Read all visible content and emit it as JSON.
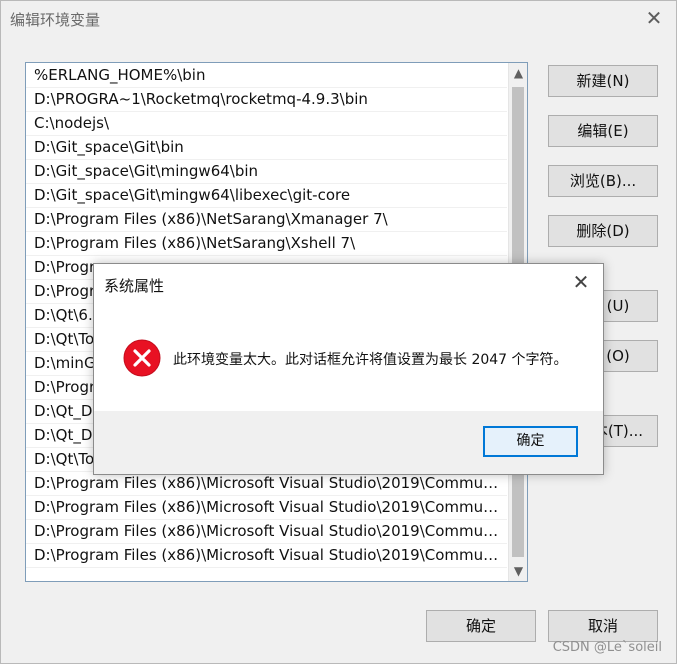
{
  "window": {
    "title": "编辑环境变量",
    "close_glyph": "✕"
  },
  "paths": [
    "%ERLANG_HOME%\\bin",
    "D:\\PROGRA~1\\Rocketmq\\rocketmq-4.9.3\\bin",
    "C:\\nodejs\\",
    "D:\\Git_space\\Git\\bin",
    "D:\\Git_space\\Git\\mingw64\\bin",
    "D:\\Git_space\\Git\\mingw64\\libexec\\git-core",
    "D:\\Program Files (x86)\\NetSarang\\Xmanager 7\\",
    "D:\\Program Files (x86)\\NetSarang\\Xshell 7\\",
    "D:\\Progr",
    "D:\\Progr",
    "D:\\Qt\\6.6",
    "D:\\Qt\\To",
    "D:\\minGw",
    "D:\\Progr",
    "D:\\Qt_De",
    "D:\\Qt_De",
    "D:\\Qt\\To",
    "D:\\Program Files (x86)\\Microsoft Visual Studio\\2019\\Communit...",
    "D:\\Program Files (x86)\\Microsoft Visual Studio\\2019\\Communit...",
    "D:\\Program Files (x86)\\Microsoft Visual Studio\\2019\\Communit...",
    "D:\\Program Files (x86)\\Microsoft Visual Studio\\2019\\Communit..."
  ],
  "buttons": {
    "new": "新建(N)",
    "edit": "编辑(E)",
    "browse": "浏览(B)...",
    "delete": "删除(D)",
    "move_up_partial": "(U)",
    "move_down_partial": "(O)",
    "edit_text_partial": "本(T)...",
    "ok": "确定",
    "cancel": "取消"
  },
  "modal": {
    "title": "系统属性",
    "close_glyph": "✕",
    "message": "此环境变量太大。此对话框允许将值设置为最长 2047 个字符。",
    "ok": "确定",
    "icon": "error-icon"
  },
  "watermark": "CSDN @Le`soleil",
  "colors": {
    "error_red": "#e81123",
    "accent_blue": "#0078d7"
  }
}
